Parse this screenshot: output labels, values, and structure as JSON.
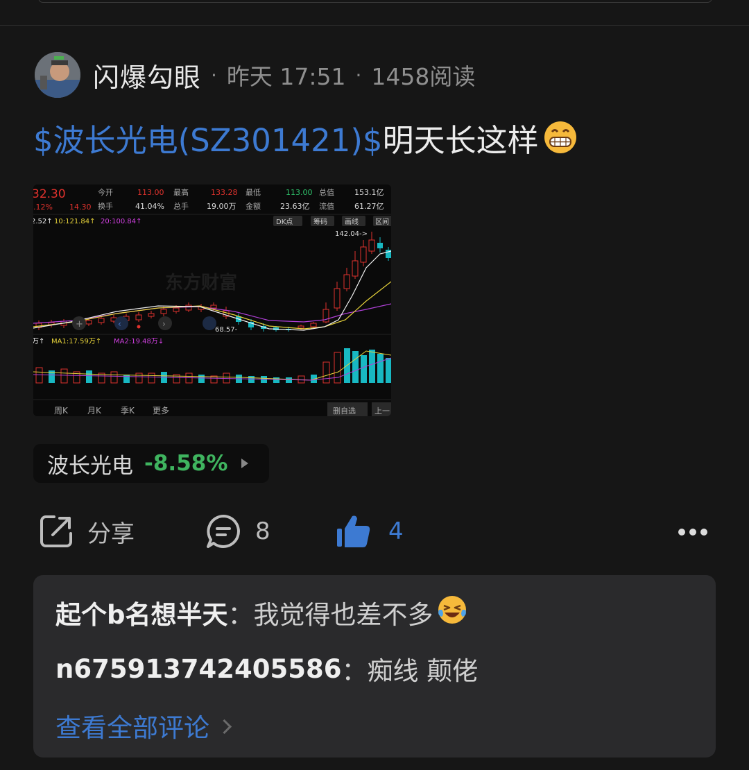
{
  "post": {
    "author": "闪爆勾眼",
    "sep1": "·",
    "time": "昨天 17:51",
    "sep2": "·",
    "reads": "1458阅读",
    "stock_link": "$波长光电(SZ301421)$",
    "text": "明天长这样",
    "emoji_icon": "grinning-face-emoji"
  },
  "chart_image": {
    "header": {
      "price": "32.30",
      "pct": "-.12%",
      "vol_ratio": "14.30",
      "open_label": "今开",
      "open": "113.00",
      "high_label": "最高",
      "high": "133.28",
      "low_label": "最低",
      "low": "113.00",
      "mcap_label": "总值",
      "mcap": "153.1亿",
      "turnover_label": "换手",
      "turnover": "41.04%",
      "vol_label": "总手",
      "vol": "19.00万",
      "amt_label": "金额",
      "amt": "23.63亿",
      "float_label": "流值",
      "float": "61.27亿"
    },
    "ma_line": {
      "ma5": "2.52↑",
      "ma10": "10:121.84↑",
      "ma20": "20:100.84↑"
    },
    "buttons": [
      "DK点",
      "筹码",
      "画线",
      "区间"
    ],
    "watermark": "东方财富",
    "high_marker": "142.04->",
    "low_marker": "68.57-",
    "vol_ma": {
      "v": "万↑",
      "ma1": "MA1:17.59万↑",
      "ma2": "MA2:19.48万↓"
    },
    "bottom_tabs": [
      "周K",
      "月K",
      "季K",
      "更多"
    ],
    "bottom_buttons": [
      "删自选",
      "上一"
    ],
    "colors": {
      "up": "#e0322d",
      "down": "#18b8c2",
      "ma_white": "#f0f0f0",
      "ma_yellow": "#e6d23a",
      "ma_purple": "#b040d8"
    }
  },
  "stock_tag": {
    "name": "波长光电",
    "change": "-8.58%"
  },
  "actions": {
    "share_label": "分享",
    "comment_count": "8",
    "like_count": "4"
  },
  "comments": [
    {
      "user": "起个b名想半天",
      "colon": "：",
      "text": "我觉得也差不多",
      "emoji_icon": "laughing-crying-emoji"
    },
    {
      "user": "n675913742405586",
      "colon": "：",
      "text": "痴线 颠佬"
    }
  ],
  "view_all_label": "查看全部评论",
  "colors": {
    "link_blue": "#3d7ad2",
    "stock_down_green": "#3fb45f",
    "background": "#161616",
    "comment_bg": "#2a2a2c"
  }
}
